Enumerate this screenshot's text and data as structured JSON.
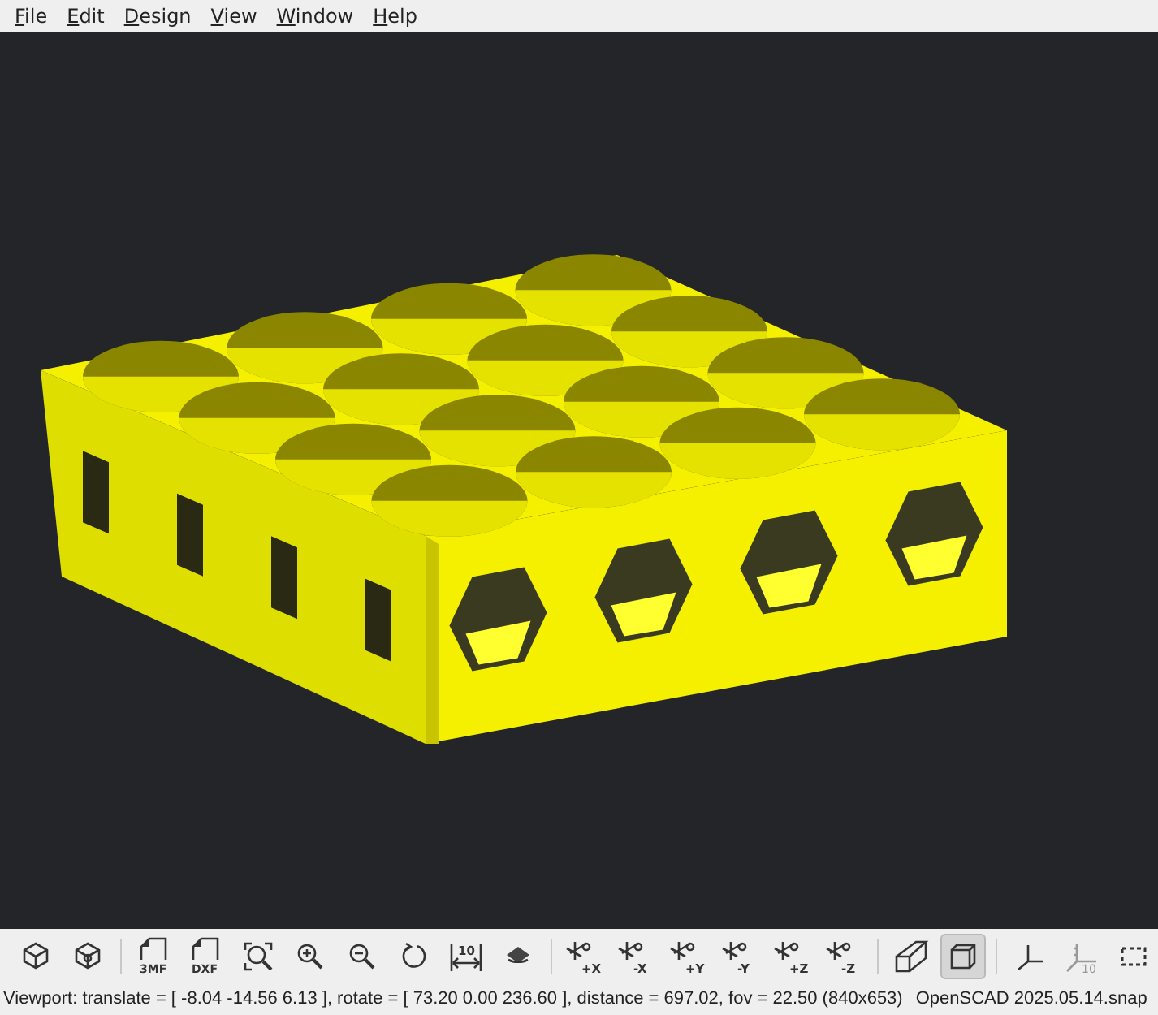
{
  "menu_bar": [
    {
      "label": "File"
    },
    {
      "label": "Edit"
    },
    {
      "label": "Design"
    },
    {
      "label": "View"
    },
    {
      "label": "Window"
    },
    {
      "label": "Help"
    }
  ],
  "toolbar": {
    "groups": [
      [
        {
          "kind": "preview",
          "pressed": false
        },
        {
          "kind": "render",
          "pressed": false
        }
      ],
      [
        {
          "kind": "export",
          "label": "3MF",
          "pressed": false
        },
        {
          "kind": "export",
          "label": "DXF",
          "pressed": false
        },
        {
          "kind": "view-all",
          "pressed": false
        },
        {
          "kind": "zoom-in",
          "pressed": false
        },
        {
          "kind": "zoom-out",
          "pressed": false
        },
        {
          "kind": "reset-view",
          "pressed": false
        },
        {
          "kind": "measure",
          "label": "10",
          "pressed": false
        },
        {
          "kind": "animate",
          "pressed": false
        }
      ],
      [
        {
          "kind": "axis-view",
          "label": "+X",
          "pressed": false
        },
        {
          "kind": "axis-view",
          "label": "-X",
          "pressed": false
        },
        {
          "kind": "axis-view",
          "label": "+Y",
          "pressed": false
        },
        {
          "kind": "axis-view",
          "label": "-Y",
          "pressed": false
        },
        {
          "kind": "axis-view",
          "label": "+Z",
          "pressed": false
        },
        {
          "kind": "axis-view",
          "label": "-Z",
          "pressed": false
        }
      ],
      [
        {
          "kind": "perspective",
          "pressed": false
        },
        {
          "kind": "orthogonal",
          "pressed": true
        }
      ],
      [
        {
          "kind": "axes",
          "pressed": false
        },
        {
          "kind": "scale-markers",
          "label": "10",
          "pressed": false
        },
        {
          "kind": "edges",
          "pressed": false
        }
      ]
    ]
  },
  "status_bar": {
    "viewport": "Viewport: translate = [ -8.04 -14.56 6.13 ], rotate = [ 73.20 0.00 236.60 ], distance = 697.02, fov = 22.50 (840x653)",
    "version": "OpenSCAD 2025.05.14.snap"
  }
}
